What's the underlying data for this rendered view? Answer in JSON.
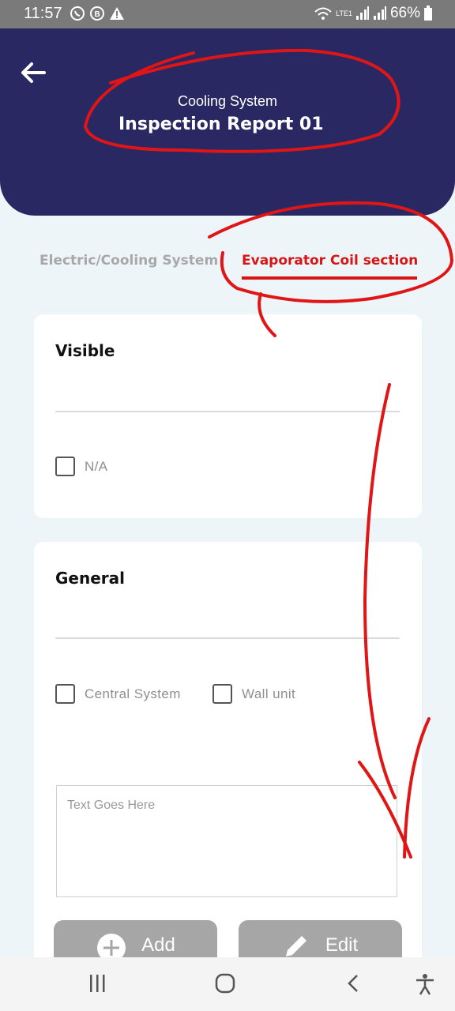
{
  "status_bar": {
    "time": "11:57",
    "battery": "66%",
    "network": "LTE1",
    "icons_left": [
      "whatsapp-icon",
      "b-icon",
      "warning-icon"
    ],
    "icons_right": [
      "wifi-icon",
      "volte-icon",
      "signal-icon",
      "signal-icon",
      "battery-icon"
    ]
  },
  "header": {
    "subtitle": "Cooling System",
    "title": "Inspection Report 01",
    "background": "#2a2862"
  },
  "tabs": [
    {
      "label": "Electric/Cooling System",
      "active": false
    },
    {
      "label": "Evaporator Coil section",
      "active": true
    }
  ],
  "visible_section": {
    "title": "Visible",
    "checkbox_label": "N/A"
  },
  "general_section": {
    "title": "General",
    "options": [
      "Central System",
      "Wall unit"
    ],
    "textarea_placeholder": "Text Goes Here",
    "add_button": "Add",
    "edit_button": "Edit"
  },
  "colors": {
    "accent_red": "#d61515",
    "header_navy": "#2a2862",
    "button_gray": "#a6a6a6"
  },
  "nav_bar": {
    "icons": [
      "recent-apps-icon",
      "home-icon",
      "back-nav-icon",
      "accessibility-icon"
    ]
  }
}
